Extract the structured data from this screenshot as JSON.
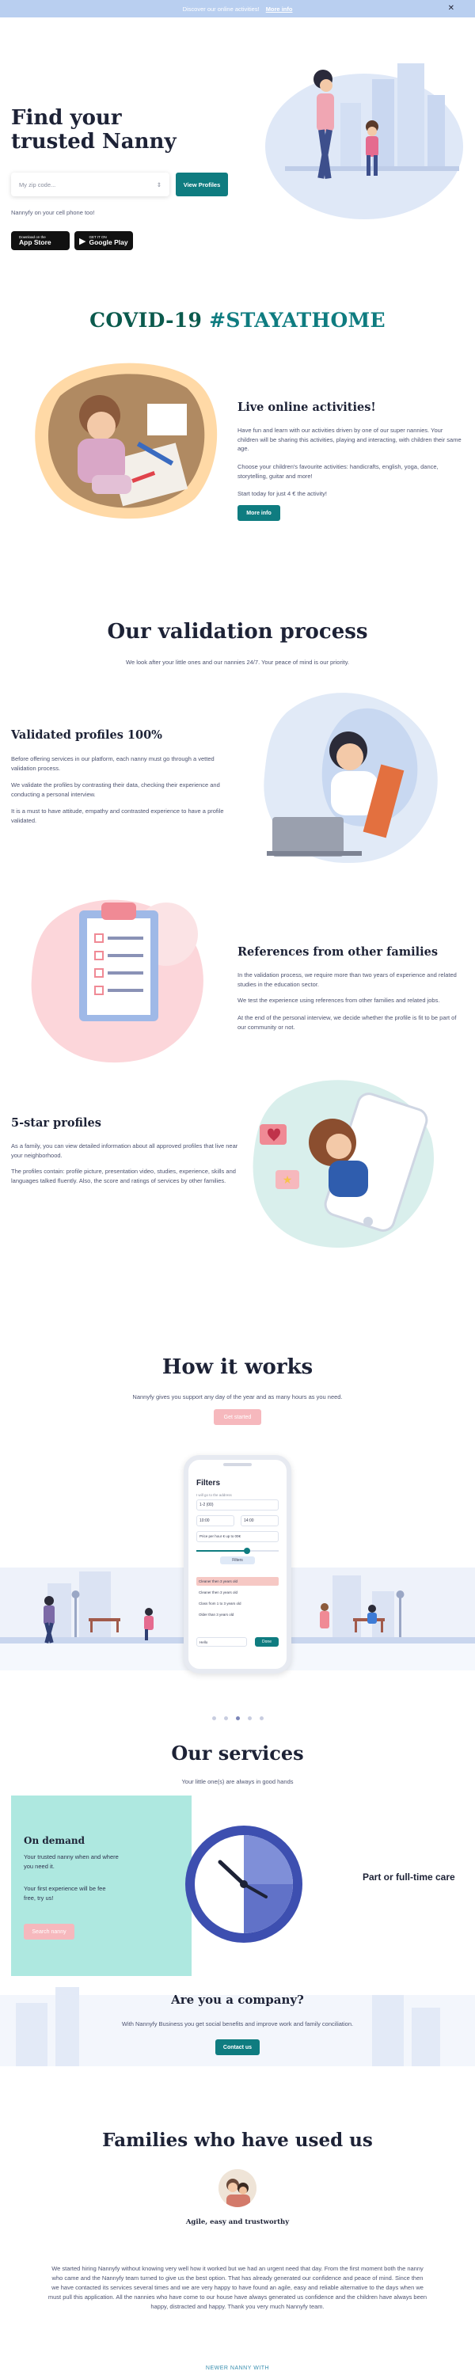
{
  "banner": {
    "text": "Discover our online activities!",
    "link": "More info",
    "close_icon": "close-icon"
  },
  "hero": {
    "title": "Find your trusted Nanny",
    "zip_placeholder": "My zip code...",
    "button": "View Profiles",
    "subtitle": "Nannyfy on your cell phone too!",
    "app_store": {
      "small": "Download on the",
      "big": "App Store"
    },
    "google_play": {
      "small": "GET IT ON",
      "big": "Google Play"
    }
  },
  "covid": {
    "title_plain": "COVID-19 ",
    "title_tag": "#STAYATHOME",
    "tag_color": "#0f7c80",
    "heading": "Live online activities!",
    "p1": "Have fun and learn with our activities driven by one of our super nannies. Your children will be sharing this activities, playing and interacting, with children their same age.",
    "p2": "Choose your children's favourite activities: handicrafts, english, yoga, dance, storytelling, guitar and more!",
    "p3": "Start today for just 4 € the activity!",
    "button": "More info"
  },
  "validation": {
    "title": "Our validation process",
    "subtitle": "We look after your little ones and our nannies 24/7. Your peace of mind is our priority.",
    "items": [
      {
        "heading": "Validated profiles 100%",
        "p1": "Before offering services in our platform, each nanny must go through a vetted validation process.",
        "p2": "We validate the profiles by contrasting their data, checking their experience and conducting a personal interview.",
        "p3": "It is a must to have attitude, empathy and contrasted experience to have a profile validated."
      },
      {
        "heading": "References from other families",
        "p1": "In the validation process, we require more than two years of experience and related studies in the education sector.",
        "p2": "We test the experience using references from other families and related jobs.",
        "p3": "At the end of the personal interview, we decide whether the profile is fit to be part of our community or not."
      },
      {
        "heading": "5-star profiles",
        "p1": "As a family, you can view detailed information about all approved profiles that live near your neighborhood.",
        "p2": "The profiles contain: profile picture, presentation video, studies, experience, skills and languages talked fluently. Also, the score and ratings of services by other families."
      }
    ]
  },
  "how": {
    "title": "How it works",
    "subtitle": "Nannyfy gives you support any day of the year and as many hours as you need.",
    "button": "Get started",
    "phone": {
      "title": "Filters",
      "label_location": "I will go to the address",
      "zip": "1-2 (00)",
      "time_from": "10:00",
      "time_to": "14:00",
      "price": "Price per hour € up to 00€",
      "button": "Filters",
      "rows": [
        "Cleaner then 3 years old",
        "Cleaner then 3 years old",
        "Class from 1 to 3 years old",
        "Older than 3 years old"
      ],
      "bottom_label": "Hello",
      "submit": "Done"
    },
    "dots": 5,
    "active_dot": 2
  },
  "services": {
    "title": "Our services",
    "subtitle": "Your little one(s) are always in good hands",
    "on_demand": {
      "heading": "On demand",
      "p1": "Your trusted nanny when and where you need it.",
      "p2": "Your first experience will be fee free, try us!",
      "button": "Search nanny"
    },
    "right": "Part or full-time care"
  },
  "company": {
    "title": "Are you a company?",
    "subtitle": "With Nannyfy Business you get social benefits and improve work and family conciliation.",
    "button": "Contact us"
  },
  "families": {
    "title": "Families who have used us",
    "testimonial_title": "Agile, easy and trustworthy",
    "testimonial": "We started hiring Nannyfy without knowing very well how it worked but we had an urgent need that day. From the first moment both the nanny who came and the Nannyfy team turned to give us the best option. That has already generated our confidence and peace of mind. Since then we have contacted its services several times and we are very happy to have found an agile, easy and reliable alternative to the days when we must pull this application. All the nannies who have come to our house have always generated us confidence and the children have always been happy, distracted and happy. Thank you very much Nannyfy team.",
    "more": "NEWER NANNY WITH"
  }
}
